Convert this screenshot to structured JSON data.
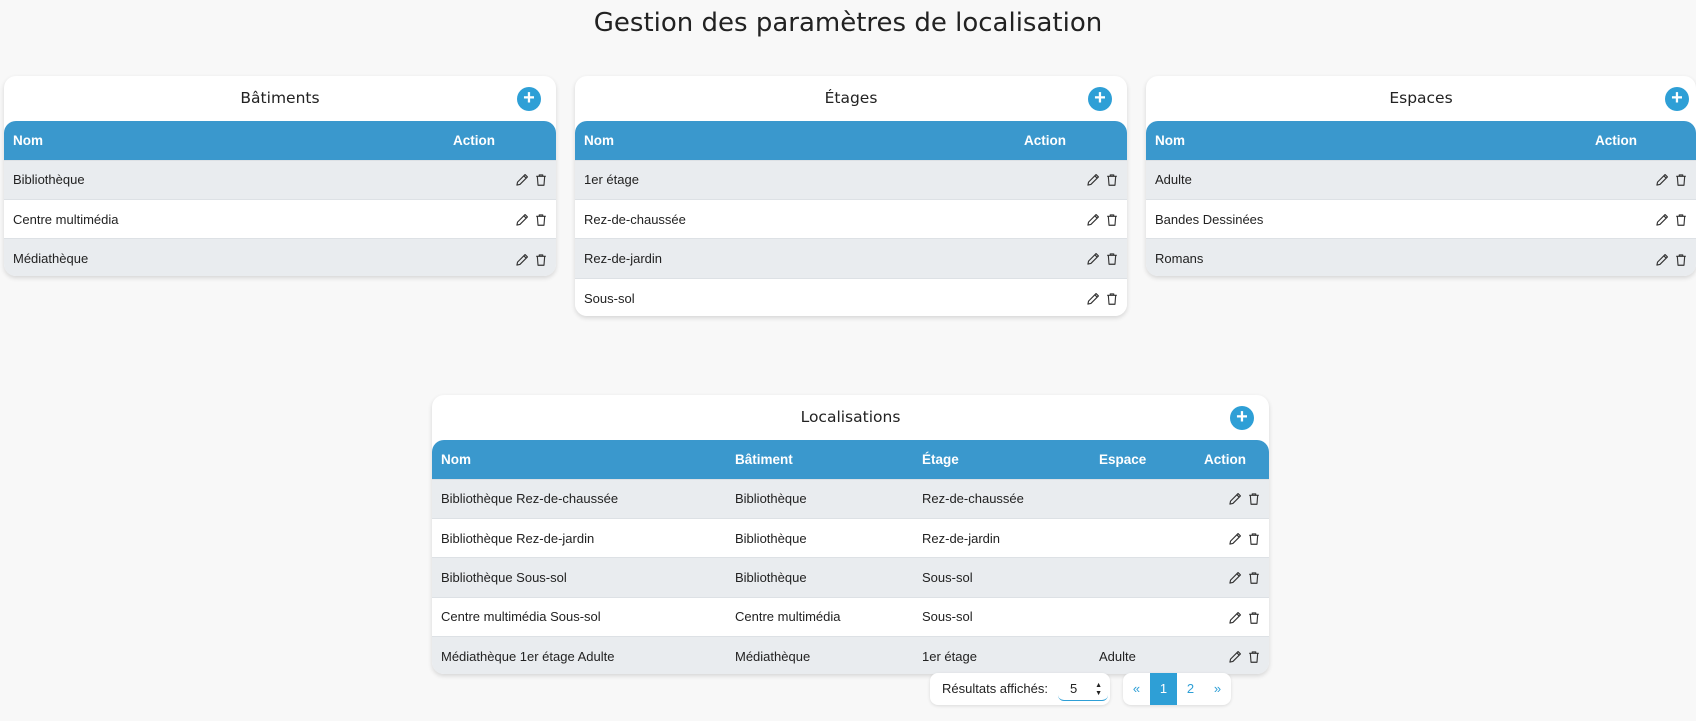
{
  "title": "Gestion des paramètres de localisation",
  "batiments": {
    "title": "Bâtiments",
    "add_label": "+",
    "headers": [
      "Nom",
      "Action"
    ],
    "rows": [
      "Bibliothèque",
      "Centre multimédia",
      "Médiathèque"
    ]
  },
  "etages": {
    "title": "Étages",
    "add_label": "+",
    "headers": [
      "Nom",
      "Action"
    ],
    "rows": [
      "1er étage",
      "Rez-de-chaussée",
      "Rez-de-jardin",
      "Sous-sol"
    ]
  },
  "espaces": {
    "title": "Espaces",
    "add_label": "+",
    "headers": [
      "Nom",
      "Action"
    ],
    "rows": [
      "Adulte",
      "Bandes Dessinées",
      "Romans"
    ]
  },
  "localisations": {
    "title": "Localisations",
    "add_label": "+",
    "headers": [
      "Nom",
      "Bâtiment",
      "Étage",
      "Espace",
      "Action"
    ],
    "rows": [
      [
        "Bibliothèque Rez-de-chaussée",
        "Bibliothèque",
        "Rez-de-chaussée",
        ""
      ],
      [
        "Bibliothèque Rez-de-jardin",
        "Bibliothèque",
        "Rez-de-jardin",
        ""
      ],
      [
        "Bibliothèque Sous-sol",
        "Bibliothèque",
        "Sous-sol",
        ""
      ],
      [
        "Centre multimédia Sous-sol",
        "Centre multimédia",
        "Sous-sol",
        ""
      ],
      [
        "Médiathèque 1er étage Adulte",
        "Médiathèque",
        "1er étage",
        "Adulte"
      ]
    ]
  },
  "results": {
    "label": "Résultats affichés:",
    "value": "5"
  },
  "pagination": {
    "prev": "«",
    "pages": [
      "1",
      "2"
    ],
    "active_page": "1",
    "next": "»"
  },
  "icons": [
    "pencil-icon",
    "trash-icon"
  ],
  "colors": {
    "header_blue": "#3a98cd",
    "accent": "#2e9fd6",
    "row_stripe": "#e9ecef",
    "background": "#f8f8f8"
  }
}
